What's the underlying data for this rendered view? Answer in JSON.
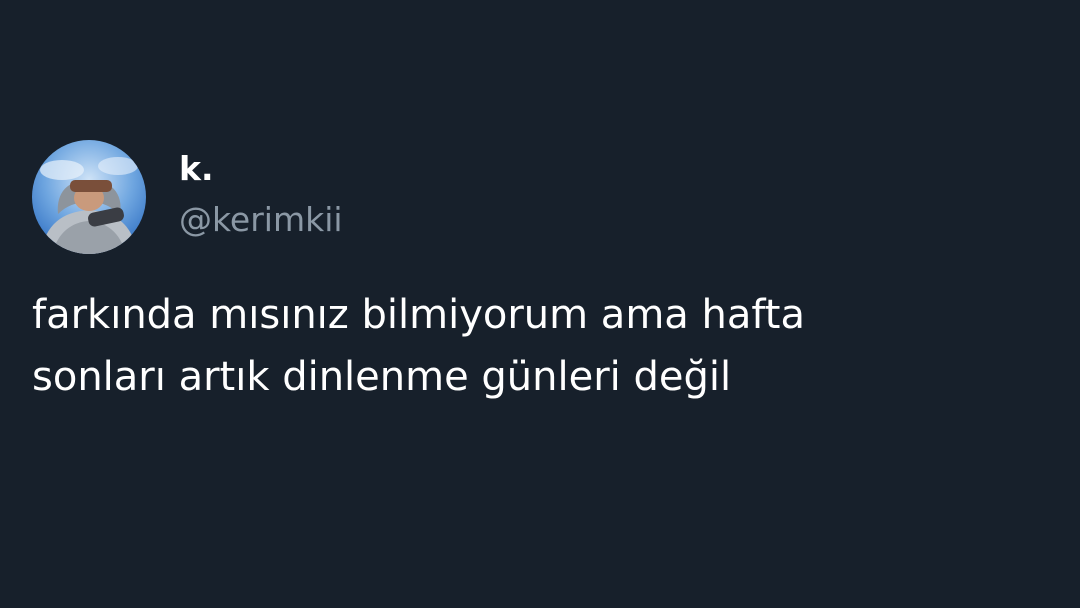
{
  "tweet": {
    "author": {
      "display_name": "k.",
      "handle": "@kerimkii",
      "avatar_icon": "profile-photo"
    },
    "text_lines": [
      "farkında mısınız bilmiyorum ama hafta",
      "sonları artık dinlenme günleri değil"
    ]
  },
  "colors": {
    "background": "#17202b",
    "name": "#ffffff",
    "handle": "#8b98a5",
    "text": "#ffffff"
  }
}
